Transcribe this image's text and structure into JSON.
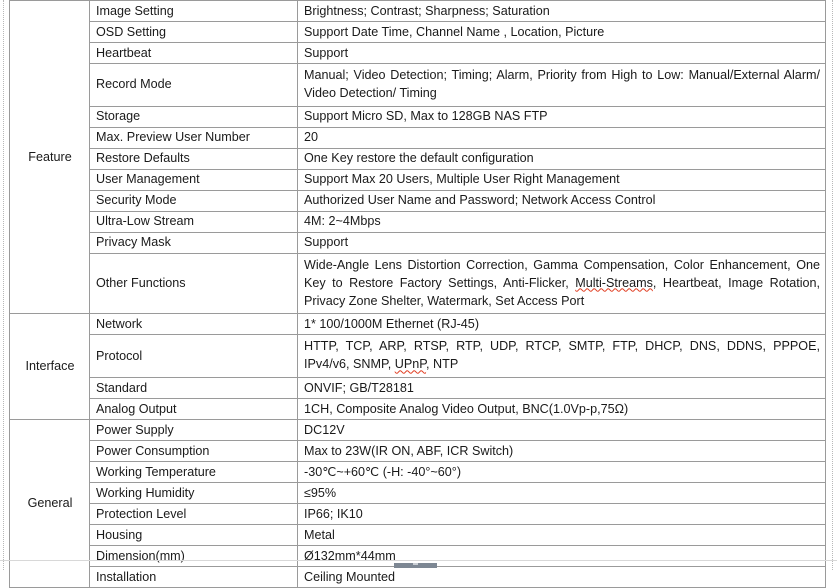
{
  "document": {
    "type": "specification-table",
    "title": "IP Camera Specification Table"
  },
  "groups": [
    {
      "label": "Feature",
      "rows": [
        {
          "item": "Image Setting",
          "value": "Brightness; Contrast; Sharpness; Saturation"
        },
        {
          "item": "OSD Setting",
          "value": "Support Date Time, Channel Name , Location, Picture"
        },
        {
          "item": "Heartbeat",
          "value": "Support"
        },
        {
          "item": "Record Mode",
          "value": "Manual; Video Detection; Timing; Alarm, Priority from High to Low: Manual/External Alarm/ Video Detection/ Timing"
        },
        {
          "item": "Storage",
          "value": "Support Micro SD, Max to 128GB NAS FTP"
        },
        {
          "item": "Max. Preview User Number",
          "value": "20"
        },
        {
          "item": "Restore Defaults",
          "value": "One Key restore the default configuration"
        },
        {
          "item": "User Management",
          "value": "Support Max 20 Users, Multiple User Right Management"
        },
        {
          "item": "Security Mode",
          "value": "Authorized User Name and Password; Network Access Control"
        },
        {
          "item": "Ultra-Low Stream",
          "value": "4M: 2~4Mbps"
        },
        {
          "item": "Privacy Mask",
          "value": "Support"
        },
        {
          "item": "Other Functions",
          "value": "Wide-Angle Lens Distortion Correction, Gamma Compensation, Color Enhancement, One Key to Restore Factory Settings, Anti-Flicker, Multi-Streams, Heartbeat, Image Rotation, Privacy Zone Shelter, Watermark, Set Access Port"
        }
      ]
    },
    {
      "label": "Interface",
      "rows": [
        {
          "item": "Network",
          "value": "1* 100/1000M Ethernet (RJ-45)"
        },
        {
          "item": "Protocol",
          "value": "HTTP, TCP, ARP, RTSP, RTP, UDP, RTCP, SMTP, FTP, DHCP, DNS, DDNS, PPPOE, IPv4/v6, SNMP, UPnP, NTP"
        },
        {
          "item": "Standard",
          "value": "ONVIF; GB/T28181"
        },
        {
          "item": "Analog Output",
          "value": "1CH, Composite Analog Video Output, BNC(1.0Vp-p,75Ω)"
        }
      ]
    },
    {
      "label": "General",
      "rows": [
        {
          "item": "Power Supply",
          "value": "DC12V"
        },
        {
          "item": "Power Consumption",
          "value": "Max to 23W(IR ON, ABF, ICR Switch)"
        },
        {
          "item": "Working Temperature",
          "value": "-30℃~+60℃ (-H: -40°~60°)"
        },
        {
          "item": "Working Humidity",
          "value": "≤95%"
        },
        {
          "item": "Protection Level",
          "value": "IP66; IK10"
        },
        {
          "item": "Housing",
          "value": "Metal"
        },
        {
          "item": "Dimension(mm)",
          "value": "Ø132mm*44mm"
        },
        {
          "item": "Installation",
          "value": "Ceiling Mounted"
        }
      ]
    }
  ],
  "spellcheck_words": [
    "Multi-Streams",
    "UPnP"
  ],
  "record_mode_lines": [
    "Manual;   Video   Detection;   Timing;   Alarm,   Priority   from   High   to   Low:",
    "Manual/External Alarm/ Video Detection/ Timing"
  ],
  "other_functions_lines": [
    "Wide-Angle   Lens   Distortion   Correction,   Gamma   Compensation,   Color",
    "Enhancement, One Key to Restore Factory Settings, Anti-Flicker, Multi-Streams,",
    "Heartbeat, Image Rotation, Privacy Zone Shelter, Watermark, Set Access Port"
  ],
  "protocol_lines": [
    "HTTP,  TCP,  ARP,  RTSP,  RTP,  UDP,  RTCP,  SMTP,  FTP,  DHCP,  DNS,  DDNS,  PPPOE,",
    "IPv4/v6, SNMP, UPnP, NTP"
  ],
  "colors": {
    "border": "#9a9a9a",
    "text": "#1a1a1a",
    "spellcheck": "#e03b1f",
    "margin_guide": "#b8b8b8",
    "scroll_thumb": "#7d8793"
  }
}
